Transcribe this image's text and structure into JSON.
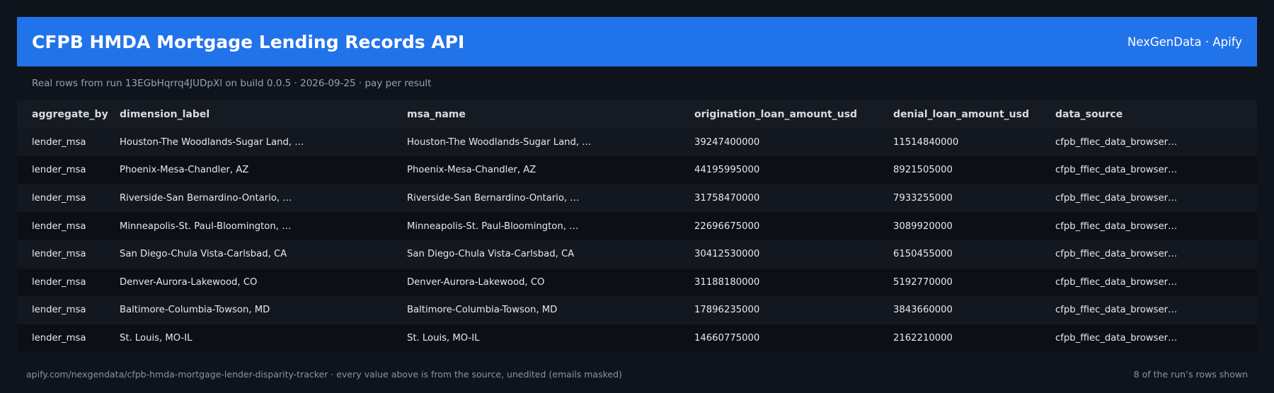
{
  "header": {
    "title": "CFPB HMDA Mortgage Lending Records API",
    "brand": "NexGenData · Apify"
  },
  "subtitle": "Real rows from run 13EGbHqrrq4JUDpXl on build 0.0.5 · 2026-09-25 · pay per result",
  "table": {
    "columns": [
      "aggregate_by",
      "dimension_label",
      "msa_name",
      "origination_loan_amount_usd",
      "denial_loan_amount_usd",
      "data_source"
    ],
    "rows": [
      [
        "lender_msa",
        "Houston-The Woodlands-Sugar Land, …",
        "Houston-The Woodlands-Sugar Land, …",
        "39247400000",
        "11514840000",
        "cfpb_ffiec_data_browser…"
      ],
      [
        "lender_msa",
        "Phoenix-Mesa-Chandler, AZ",
        "Phoenix-Mesa-Chandler, AZ",
        "44195995000",
        "8921505000",
        "cfpb_ffiec_data_browser…"
      ],
      [
        "lender_msa",
        "Riverside-San Bernardino-Ontario, …",
        "Riverside-San Bernardino-Ontario, …",
        "31758470000",
        "7933255000",
        "cfpb_ffiec_data_browser…"
      ],
      [
        "lender_msa",
        "Minneapolis-St. Paul-Bloomington, …",
        "Minneapolis-St. Paul-Bloomington, …",
        "22696675000",
        "3089920000",
        "cfpb_ffiec_data_browser…"
      ],
      [
        "lender_msa",
        "San Diego-Chula Vista-Carlsbad, CA",
        "San Diego-Chula Vista-Carlsbad, CA",
        "30412530000",
        "6150455000",
        "cfpb_ffiec_data_browser…"
      ],
      [
        "lender_msa",
        "Denver-Aurora-Lakewood, CO",
        "Denver-Aurora-Lakewood, CO",
        "31188180000",
        "5192770000",
        "cfpb_ffiec_data_browser…"
      ],
      [
        "lender_msa",
        "Baltimore-Columbia-Towson, MD",
        "Baltimore-Columbia-Towson, MD",
        "17896235000",
        "3843660000",
        "cfpb_ffiec_data_browser…"
      ],
      [
        "lender_msa",
        "St. Louis, MO-IL",
        "St. Louis, MO-IL",
        "14660775000",
        "2162210000",
        "cfpb_ffiec_data_browser…"
      ]
    ]
  },
  "footer": {
    "left": "apify.com/nexgendata/cfpb-hmda-mortgage-lender-disparity-tracker  ·  every value above is from the source, unedited (emails masked)",
    "right": "8 of the run’s rows shown"
  },
  "colors": {
    "background": "#0f141c",
    "header": "#2173ea",
    "row_odd": "#131820",
    "row_even": "#0c1016"
  }
}
